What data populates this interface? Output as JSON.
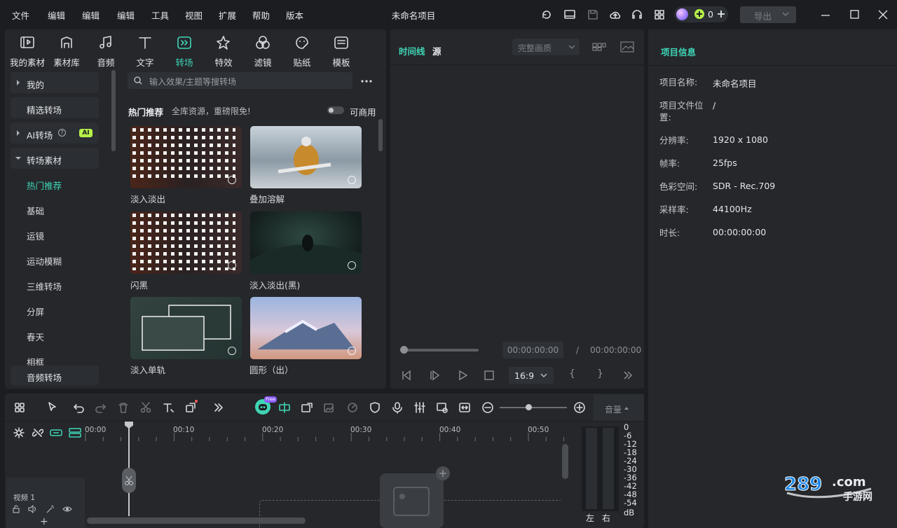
{
  "menu": {
    "file": "文件",
    "edit_partial": "编辑",
    "item2": "编辑",
    "tools": "工具",
    "view": "视图",
    "ext": "扩展",
    "help": "帮助",
    "version": "版本",
    "m1": "文件",
    "m2": "编辑"
  },
  "menu_items": [
    "文件",
    "编辑",
    "编辑",
    "工具",
    "视图",
    "扩展",
    "帮助",
    "版本"
  ],
  "title": "未命名项目",
  "credit": "0",
  "export_label": "导出",
  "categories": [
    {
      "label": "我的素材",
      "icon": "my-assets-icon"
    },
    {
      "label": "素材库",
      "icon": "stock-icon"
    },
    {
      "label": "音频",
      "icon": "music-note-icon"
    },
    {
      "label": "文字",
      "icon": "text-icon"
    },
    {
      "label": "转场",
      "icon": "transition-icon",
      "active": true
    },
    {
      "label": "特效",
      "icon": "effects-icon"
    },
    {
      "label": "滤镜",
      "icon": "filter-icon"
    },
    {
      "label": "贴纸",
      "icon": "sticker-icon"
    },
    {
      "label": "模板",
      "icon": "template-icon"
    }
  ],
  "sidebar": {
    "mine": "我的",
    "featured": "精选转场",
    "ai": "AI转场",
    "ai_badge": "AI",
    "material": "转场素材",
    "subs": [
      "热门推荐",
      "基础",
      "运镜",
      "运动模糊",
      "三维转场",
      "分屏",
      "春天",
      "相框"
    ],
    "audio": "音频转场"
  },
  "search": {
    "placeholder": "输入效果/主题等搜转场"
  },
  "section": {
    "title": "热门推荐",
    "subtitle": "全库资源，重磅限免!",
    "commercial": "可商用"
  },
  "items": [
    "淡入淡出",
    "叠加溶解",
    "闪黑",
    "淡入淡出(黑)",
    "淡入单轨",
    "圆形（出）"
  ],
  "preview": {
    "tab_timeline": "时间线",
    "tab_source": "源",
    "quality": "完整画质",
    "time_current": "00:00:00:00",
    "separator": "/",
    "time_total": "00:00:00:00",
    "ratio": "16:9"
  },
  "info": {
    "heading": "项目信息",
    "rows": [
      {
        "k": "项目名称:",
        "v": "未命名项目"
      },
      {
        "k": "项目文件位置:",
        "v": "/"
      },
      {
        "k": "分辨率:",
        "v": "1920 x 1080"
      },
      {
        "k": "帧率:",
        "v": "25fps"
      },
      {
        "k": "色彩空间:",
        "v": "SDR - Rec.709"
      },
      {
        "k": "采样率:",
        "v": "44100Hz"
      },
      {
        "k": "时长:",
        "v": "00:00:00:00"
      }
    ]
  },
  "timeline": {
    "ruler": [
      "00:00",
      "00:10",
      "00:20",
      "00:30",
      "00:40",
      "00:50"
    ],
    "track": "视频 1",
    "volume": "音量",
    "free_badge": "Free",
    "db_scale": [
      "0",
      "-6",
      "-12",
      "-18",
      "-24",
      "-30",
      "-36",
      "-42",
      "-48",
      "-54"
    ],
    "db_unit": "dB",
    "left": "左",
    "right": "右"
  },
  "watermark": "289.com 手游网"
}
